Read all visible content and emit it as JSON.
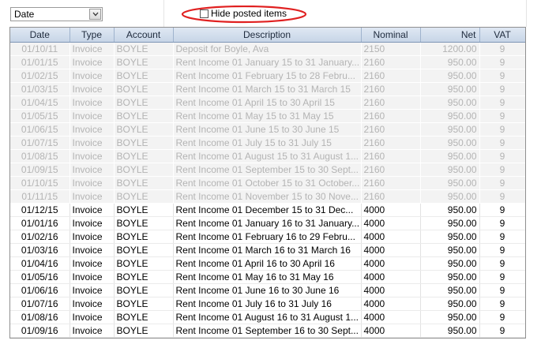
{
  "sort": {
    "selected": "Date"
  },
  "hide_posted": {
    "label": "Hide posted items",
    "checked": false
  },
  "annotation_color": "#e02020",
  "columns": [
    "Date",
    "Type",
    "Account",
    "Description",
    "Nominal",
    "Net",
    "VAT"
  ],
  "rows": [
    {
      "date": "01/10/11",
      "type": "Invoice",
      "account": "BOYLE",
      "description": "Deposit for Boyle, Ava",
      "nominal": "2150",
      "net": "1200.00",
      "vat": "9",
      "posted": true
    },
    {
      "date": "01/01/15",
      "type": "Invoice",
      "account": "BOYLE",
      "description": "Rent Income 01 January 15 to 31 January...",
      "nominal": "2160",
      "net": "950.00",
      "vat": "9",
      "posted": true
    },
    {
      "date": "01/02/15",
      "type": "Invoice",
      "account": "BOYLE",
      "description": "Rent Income 01 February 15 to 28 Febru...",
      "nominal": "2160",
      "net": "950.00",
      "vat": "9",
      "posted": true
    },
    {
      "date": "01/03/15",
      "type": "Invoice",
      "account": "BOYLE",
      "description": "Rent Income 01 March 15 to 31 March 15",
      "nominal": "2160",
      "net": "950.00",
      "vat": "9",
      "posted": true
    },
    {
      "date": "01/04/15",
      "type": "Invoice",
      "account": "BOYLE",
      "description": "Rent Income 01 April 15 to 30 April 15",
      "nominal": "2160",
      "net": "950.00",
      "vat": "9",
      "posted": true
    },
    {
      "date": "01/05/15",
      "type": "Invoice",
      "account": "BOYLE",
      "description": "Rent Income 01 May 15 to 31 May 15",
      "nominal": "2160",
      "net": "950.00",
      "vat": "9",
      "posted": true
    },
    {
      "date": "01/06/15",
      "type": "Invoice",
      "account": "BOYLE",
      "description": "Rent Income 01 June 15 to 30 June 15",
      "nominal": "2160",
      "net": "950.00",
      "vat": "9",
      "posted": true
    },
    {
      "date": "01/07/15",
      "type": "Invoice",
      "account": "BOYLE",
      "description": "Rent Income 01 July 15 to 31 July 15",
      "nominal": "2160",
      "net": "950.00",
      "vat": "9",
      "posted": true
    },
    {
      "date": "01/08/15",
      "type": "Invoice",
      "account": "BOYLE",
      "description": "Rent Income 01 August 15 to 31 August 1...",
      "nominal": "2160",
      "net": "950.00",
      "vat": "9",
      "posted": true
    },
    {
      "date": "01/09/15",
      "type": "Invoice",
      "account": "BOYLE",
      "description": "Rent Income 01 September 15 to 30 Sept...",
      "nominal": "2160",
      "net": "950.00",
      "vat": "9",
      "posted": true
    },
    {
      "date": "01/10/15",
      "type": "Invoice",
      "account": "BOYLE",
      "description": "Rent Income 01 October 15 to 31 October...",
      "nominal": "2160",
      "net": "950.00",
      "vat": "9",
      "posted": true
    },
    {
      "date": "01/11/15",
      "type": "Invoice",
      "account": "BOYLE",
      "description": "Rent Income 01 November 15 to 30 Nove...",
      "nominal": "2160",
      "net": "950.00",
      "vat": "9",
      "posted": true
    },
    {
      "date": "01/12/15",
      "type": "Invoice",
      "account": "BOYLE",
      "description": "Rent Income 01 December 15 to 31 Dec...",
      "nominal": "4000",
      "net": "950.00",
      "vat": "9",
      "posted": false
    },
    {
      "date": "01/01/16",
      "type": "Invoice",
      "account": "BOYLE",
      "description": "Rent Income 01 January 16 to 31 January...",
      "nominal": "4000",
      "net": "950.00",
      "vat": "9",
      "posted": false
    },
    {
      "date": "01/02/16",
      "type": "Invoice",
      "account": "BOYLE",
      "description": "Rent Income 01 February 16 to 29 Febru...",
      "nominal": "4000",
      "net": "950.00",
      "vat": "9",
      "posted": false
    },
    {
      "date": "01/03/16",
      "type": "Invoice",
      "account": "BOYLE",
      "description": "Rent Income 01 March 16 to 31 March 16",
      "nominal": "4000",
      "net": "950.00",
      "vat": "9",
      "posted": false
    },
    {
      "date": "01/04/16",
      "type": "Invoice",
      "account": "BOYLE",
      "description": "Rent Income 01 April 16 to 30 April 16",
      "nominal": "4000",
      "net": "950.00",
      "vat": "9",
      "posted": false
    },
    {
      "date": "01/05/16",
      "type": "Invoice",
      "account": "BOYLE",
      "description": "Rent Income 01 May 16 to 31 May 16",
      "nominal": "4000",
      "net": "950.00",
      "vat": "9",
      "posted": false
    },
    {
      "date": "01/06/16",
      "type": "Invoice",
      "account": "BOYLE",
      "description": "Rent Income 01 June 16 to 30 June 16",
      "nominal": "4000",
      "net": "950.00",
      "vat": "9",
      "posted": false
    },
    {
      "date": "01/07/16",
      "type": "Invoice",
      "account": "BOYLE",
      "description": "Rent Income 01 July 16 to 31 July 16",
      "nominal": "4000",
      "net": "950.00",
      "vat": "9",
      "posted": false
    },
    {
      "date": "01/08/16",
      "type": "Invoice",
      "account": "BOYLE",
      "description": "Rent Income 01 August 16 to 31 August 1...",
      "nominal": "4000",
      "net": "950.00",
      "vat": "9",
      "posted": false
    },
    {
      "date": "01/09/16",
      "type": "Invoice",
      "account": "BOYLE",
      "description": "Rent Income 01 September 16 to 30 Sept...",
      "nominal": "4000",
      "net": "950.00",
      "vat": "9",
      "posted": false
    }
  ]
}
